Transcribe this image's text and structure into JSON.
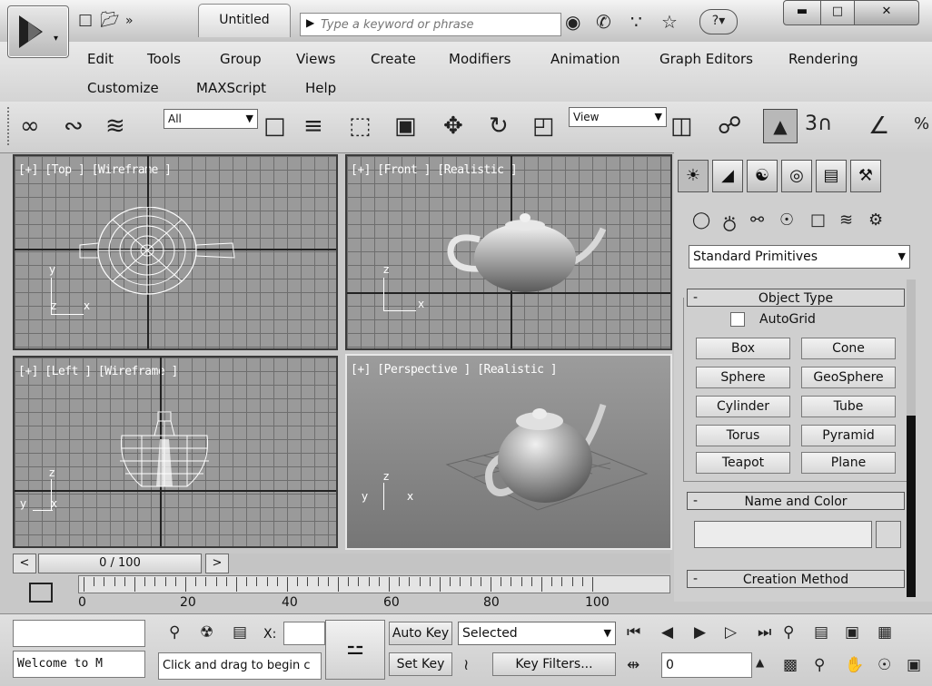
{
  "title_bar": {
    "document_title": "Untitled",
    "search_placeholder": "Type a keyword or phrase",
    "help_label": "?",
    "quick_access": [
      "new-file-icon",
      "open-folder-icon",
      "more-icon"
    ],
    "tools": [
      "binoculars-icon",
      "communication-center-icon",
      "satellite-icon",
      "favorites-star-icon"
    ],
    "window_controls": [
      "minimize-icon",
      "maximize-icon",
      "close-icon"
    ]
  },
  "menu": {
    "row1": [
      "Edit",
      "Tools",
      "Group",
      "Views",
      "Create",
      "Modifiers",
      "Animation",
      "Graph Editors",
      "Rendering"
    ],
    "row2": [
      "Customize",
      "MAXScript",
      "Help"
    ]
  },
  "main_toolbar": {
    "selection_filter": "All",
    "ref_coord": "View",
    "snap_label": "3"
  },
  "viewports": {
    "top": "[+] [Top ] [Wireframe ]",
    "front": "[+] [Front ] [Realistic ]",
    "left": "[+] [Left ] [Wireframe ]",
    "perspective": "[+] [Perspective ] [Realistic ]",
    "axis_y": "y",
    "axis_x": "x",
    "axis_z": "z"
  },
  "command_panel": {
    "category": "Standard Primitives",
    "object_type_title": "Object Type",
    "autogrid_label": "AutoGrid",
    "primitives": [
      "Box",
      "Cone",
      "Sphere",
      "GeoSphere",
      "Cylinder",
      "Tube",
      "Torus",
      "Pyramid",
      "Teapot",
      "Plane"
    ],
    "name_color_title": "Name and Color",
    "creation_method_title": "Creation Method",
    "rollout_minus": "-"
  },
  "time_slider": {
    "prev": "<",
    "position": "0 / 100",
    "next": ">"
  },
  "track_bar": {
    "labels": [
      "0",
      "20",
      "40",
      "60",
      "80",
      "100"
    ]
  },
  "status_bar": {
    "listener_text": "Welcome to M",
    "prompt_text": "Click and drag to begin c",
    "x_label": "X:",
    "auto_key": "Auto Key",
    "set_key": "Set Key",
    "selected": "Selected",
    "key_filters": "Key Filters...",
    "frame_value": "0"
  },
  "colors": {
    "chrome": "#c8c8c8",
    "viewport_grid": "#9a9a9a",
    "active_viewport_border": "#e8e8e8"
  }
}
